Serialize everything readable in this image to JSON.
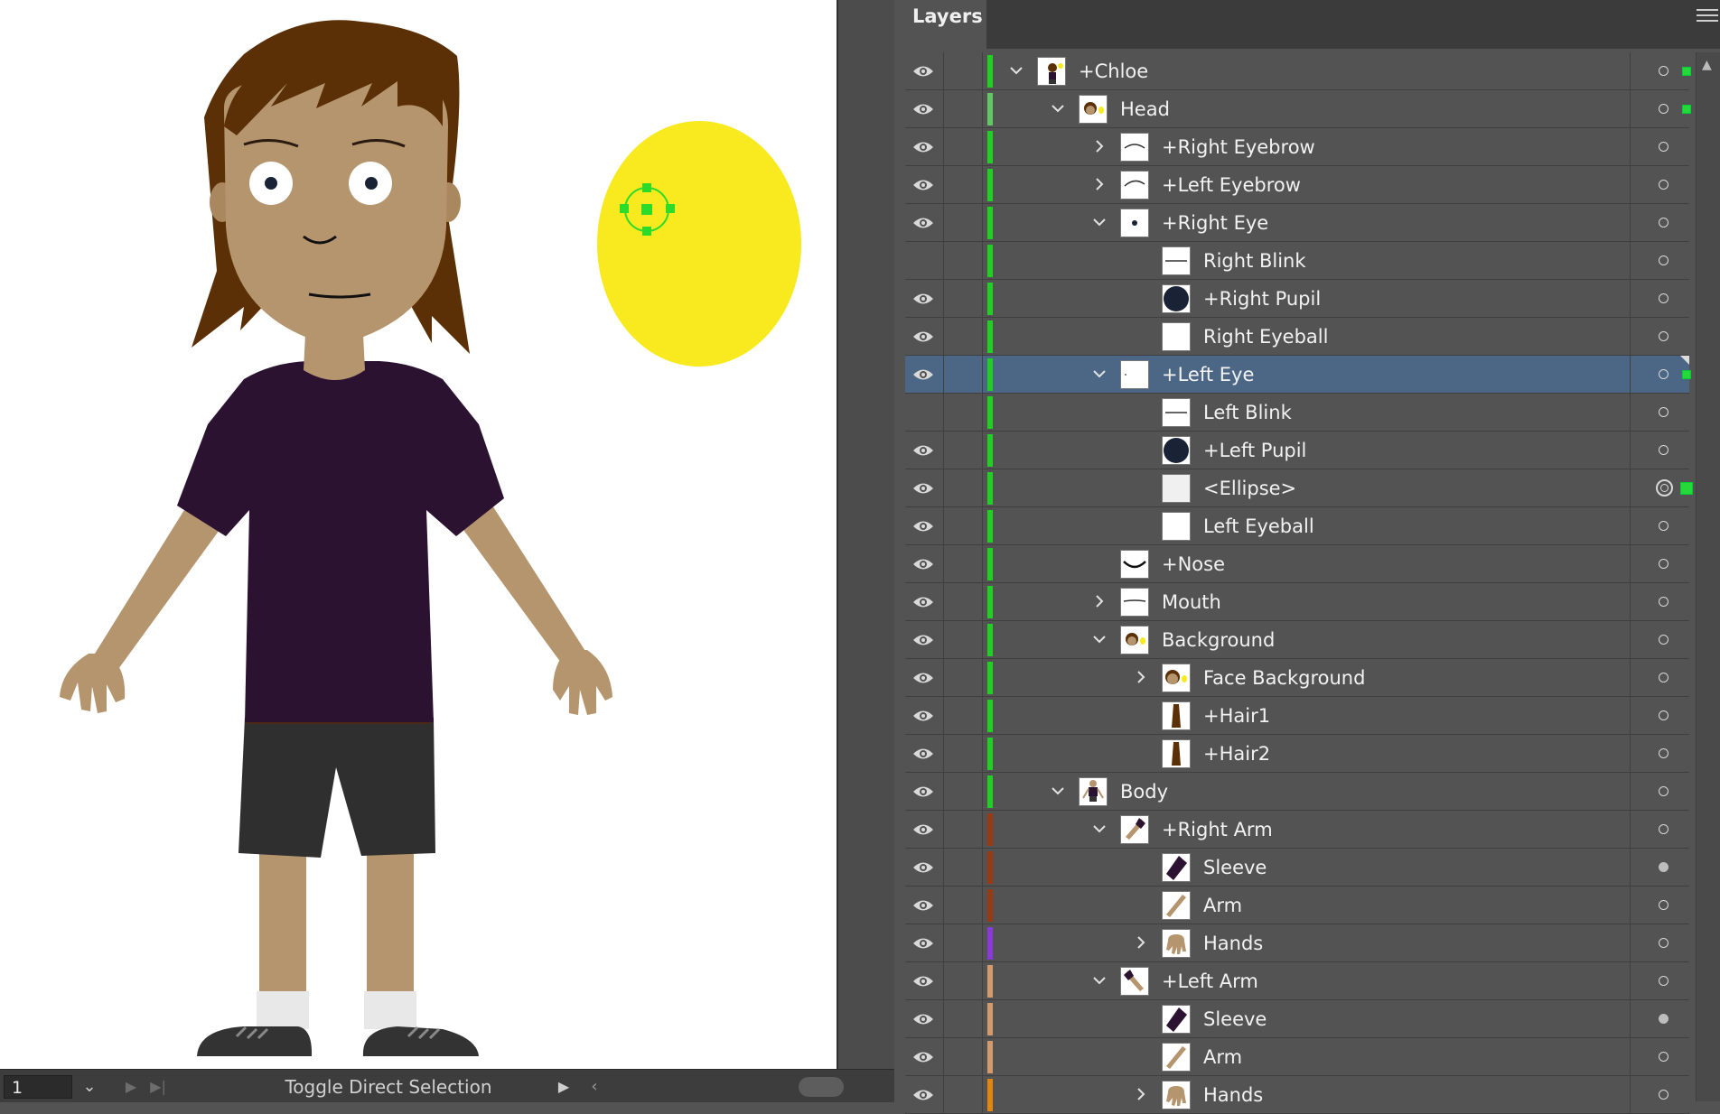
{
  "panel": {
    "title": "Layers"
  },
  "status_bar": {
    "zoom": "1",
    "status_text": "Toggle Direct Selection"
  },
  "colors": {
    "green_layer": "#20d020",
    "brown_layer": "#9a3a12",
    "purple_layer": "#8a3ad8",
    "tan_layer": "#d39a6c",
    "orange_layer": "#e6850e",
    "selected_row": "#4b6785"
  },
  "layers": [
    {
      "name": "+Chloe",
      "indent": 0,
      "visible": true,
      "expand": "open",
      "thumb": "chloe",
      "color": "#20d020",
      "target": "hollow",
      "selected_square": true
    },
    {
      "name": "Head",
      "indent": 1,
      "visible": true,
      "expand": "open",
      "thumb": "head",
      "color": "#60c860",
      "target": "hollow",
      "selected_square": true
    },
    {
      "name": "+Right Eyebrow",
      "indent": 2,
      "visible": true,
      "expand": "closed",
      "thumb": "eyebrow",
      "color": "#20d020",
      "target": "hollow"
    },
    {
      "name": "+Left Eyebrow",
      "indent": 2,
      "visible": true,
      "expand": "closed",
      "thumb": "eyebrow2",
      "color": "#20d020",
      "target": "hollow"
    },
    {
      "name": "+Right Eye",
      "indent": 2,
      "visible": true,
      "expand": "open",
      "thumb": "eye",
      "color": "#20d020",
      "target": "hollow"
    },
    {
      "name": "Right Blink",
      "indent": 3,
      "visible": false,
      "expand": "none",
      "thumb": "blink",
      "color": "#20d020",
      "target": "hollow"
    },
    {
      "name": "+Right Pupil",
      "indent": 3,
      "visible": true,
      "expand": "none",
      "thumb": "pupil",
      "color": "#20d020",
      "target": "hollow"
    },
    {
      "name": "Right Eyeball",
      "indent": 3,
      "visible": true,
      "expand": "none",
      "thumb": "blank",
      "color": "#20d020",
      "target": "hollow"
    },
    {
      "name": "+Left Eye",
      "indent": 2,
      "visible": true,
      "expand": "open",
      "thumb": "lefteye",
      "color": "#20d020",
      "target": "hollow",
      "selected": true,
      "selected_square": true
    },
    {
      "name": "Left Blink",
      "indent": 3,
      "visible": false,
      "expand": "none",
      "thumb": "blink",
      "color": "#20d020",
      "target": "hollow"
    },
    {
      "name": "+Left Pupil",
      "indent": 3,
      "visible": true,
      "expand": "none",
      "thumb": "pupil",
      "color": "#20d020",
      "target": "hollow"
    },
    {
      "name": "<Ellipse>",
      "indent": 3,
      "visible": true,
      "expand": "none",
      "thumb": "ellipse",
      "color": "#20d020",
      "target": "double",
      "selected_square": "big"
    },
    {
      "name": "Left Eyeball",
      "indent": 3,
      "visible": true,
      "expand": "none",
      "thumb": "blank",
      "color": "#20d020",
      "target": "hollow"
    },
    {
      "name": "+Nose",
      "indent": 2,
      "visible": true,
      "expand": "none",
      "thumb": "nose",
      "color": "#20d020",
      "target": "hollow"
    },
    {
      "name": "Mouth",
      "indent": 2,
      "visible": true,
      "expand": "closed",
      "thumb": "mouth",
      "color": "#20d020",
      "target": "hollow"
    },
    {
      "name": "Background",
      "indent": 2,
      "visible": true,
      "expand": "open",
      "thumb": "head",
      "color": "#20d020",
      "target": "hollow"
    },
    {
      "name": "Face Background",
      "indent": 3,
      "visible": true,
      "expand": "closed",
      "thumb": "face",
      "color": "#20d020",
      "target": "hollow"
    },
    {
      "name": "+Hair1",
      "indent": 3,
      "visible": true,
      "expand": "none",
      "thumb": "hair",
      "color": "#20d020",
      "target": "hollow"
    },
    {
      "name": "+Hair2",
      "indent": 3,
      "visible": true,
      "expand": "none",
      "thumb": "hair",
      "color": "#20d020",
      "target": "hollow"
    },
    {
      "name": "Body",
      "indent": 1,
      "visible": true,
      "expand": "open",
      "thumb": "body",
      "color": "#20d020",
      "target": "hollow"
    },
    {
      "name": "+Right Arm",
      "indent": 2,
      "visible": true,
      "expand": "open",
      "thumb": "arm",
      "color": "#9a3a12",
      "target": "hollow"
    },
    {
      "name": "Sleeve",
      "indent": 3,
      "visible": true,
      "expand": "none",
      "thumb": "sleeve",
      "color": "#9a3a12",
      "target": "filled"
    },
    {
      "name": "Arm",
      "indent": 3,
      "visible": true,
      "expand": "none",
      "thumb": "armonly",
      "color": "#9a3a12",
      "target": "hollow"
    },
    {
      "name": "Hands",
      "indent": 3,
      "visible": true,
      "expand": "closed",
      "thumb": "hands",
      "color": "#8a3ad8",
      "target": "hollow"
    },
    {
      "name": "+Left Arm",
      "indent": 2,
      "visible": true,
      "expand": "open",
      "thumb": "arm2",
      "color": "#d39a6c",
      "target": "hollow"
    },
    {
      "name": "Sleeve",
      "indent": 3,
      "visible": true,
      "expand": "none",
      "thumb": "sleeve",
      "color": "#d39a6c",
      "target": "filled"
    },
    {
      "name": "Arm",
      "indent": 3,
      "visible": true,
      "expand": "none",
      "thumb": "armonly",
      "color": "#d39a6c",
      "target": "hollow"
    },
    {
      "name": "Hands",
      "indent": 3,
      "visible": true,
      "expand": "closed",
      "thumb": "hands",
      "color": "#e6850e",
      "target": "hollow"
    }
  ]
}
